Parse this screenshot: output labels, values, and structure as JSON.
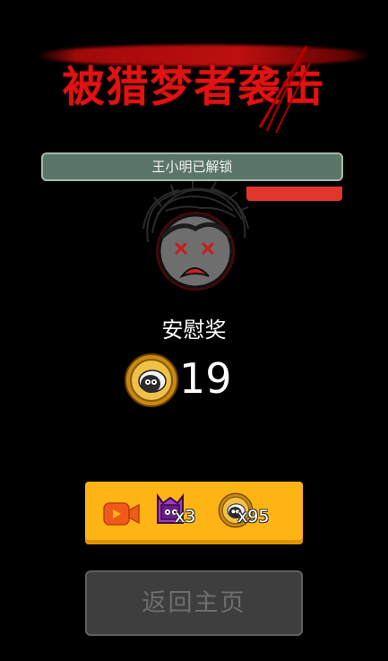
{
  "header": {
    "title": "被猎梦者袭击"
  },
  "unlock_banner": {
    "text": "王小明已解锁"
  },
  "result": {
    "prize_label": "安慰奖",
    "coin_amount": "19"
  },
  "reward_button": {
    "icon": "video-icon",
    "box_count": "x3",
    "coin_count": "x95"
  },
  "home_button": {
    "label": "返回主页"
  },
  "colors": {
    "title_red": "#e01212",
    "banner_green": "#5b7669",
    "button_yellow": "#ffb415",
    "home_gray": "#3e3e3e"
  }
}
